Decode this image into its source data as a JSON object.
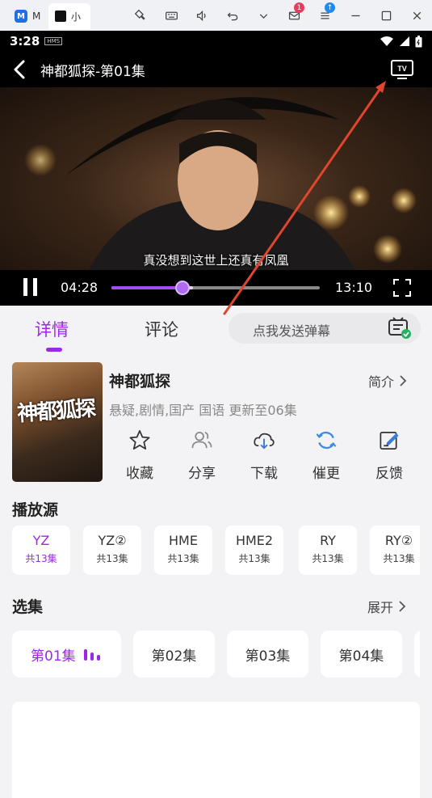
{
  "emulator": {
    "tabs": [
      {
        "label": "M"
      },
      {
        "label": "小"
      }
    ],
    "icons": [
      "pin-icon",
      "keyboard-icon",
      "volume-icon",
      "undo-icon",
      "chevron-down-icon",
      "mail-icon",
      "menu-icon",
      "minimize-icon",
      "maximize-icon",
      "close-icon"
    ],
    "mail_badge": "1"
  },
  "status_bar": {
    "time": "3:28",
    "hms_label": "HMS"
  },
  "player": {
    "title": "神都狐探-第01集",
    "subtitle_text": "真没想到这世上还真有凤凰",
    "current_time": "04:28",
    "total_time": "13:10",
    "progress": 0.34,
    "buffered": 0.39
  },
  "tabs": {
    "details": "详情",
    "comments": "评论",
    "danmu_placeholder": "点我发送弹幕"
  },
  "show": {
    "poster_title": "神都狐探",
    "title": "神都狐探",
    "intro_label": "简介",
    "meta": "悬疑,剧情,国产 国语 更新至06集"
  },
  "actions": [
    {
      "label": "收藏",
      "icon": "star-icon"
    },
    {
      "label": "分享",
      "icon": "share-users-icon"
    },
    {
      "label": "下载",
      "icon": "cloud-download-icon"
    },
    {
      "label": "催更",
      "icon": "refresh-icon"
    },
    {
      "label": "反馈",
      "icon": "edit-feedback-icon"
    }
  ],
  "sources": {
    "heading": "播放源",
    "items": [
      {
        "name": "YZ",
        "count": "共13集"
      },
      {
        "name": "YZ②",
        "count": "共13集"
      },
      {
        "name": "HME",
        "count": "共13集"
      },
      {
        "name": "HME2",
        "count": "共13集"
      },
      {
        "name": "RY",
        "count": "共13集"
      },
      {
        "name": "RY②",
        "count": "共13集"
      }
    ]
  },
  "episodes": {
    "heading": "选集",
    "expand_label": "展开",
    "items": [
      "第01集",
      "第02集",
      "第03集",
      "第04集"
    ]
  },
  "colors": {
    "accent": "#9c27e6",
    "annotation_arrow": "#e0452e"
  }
}
